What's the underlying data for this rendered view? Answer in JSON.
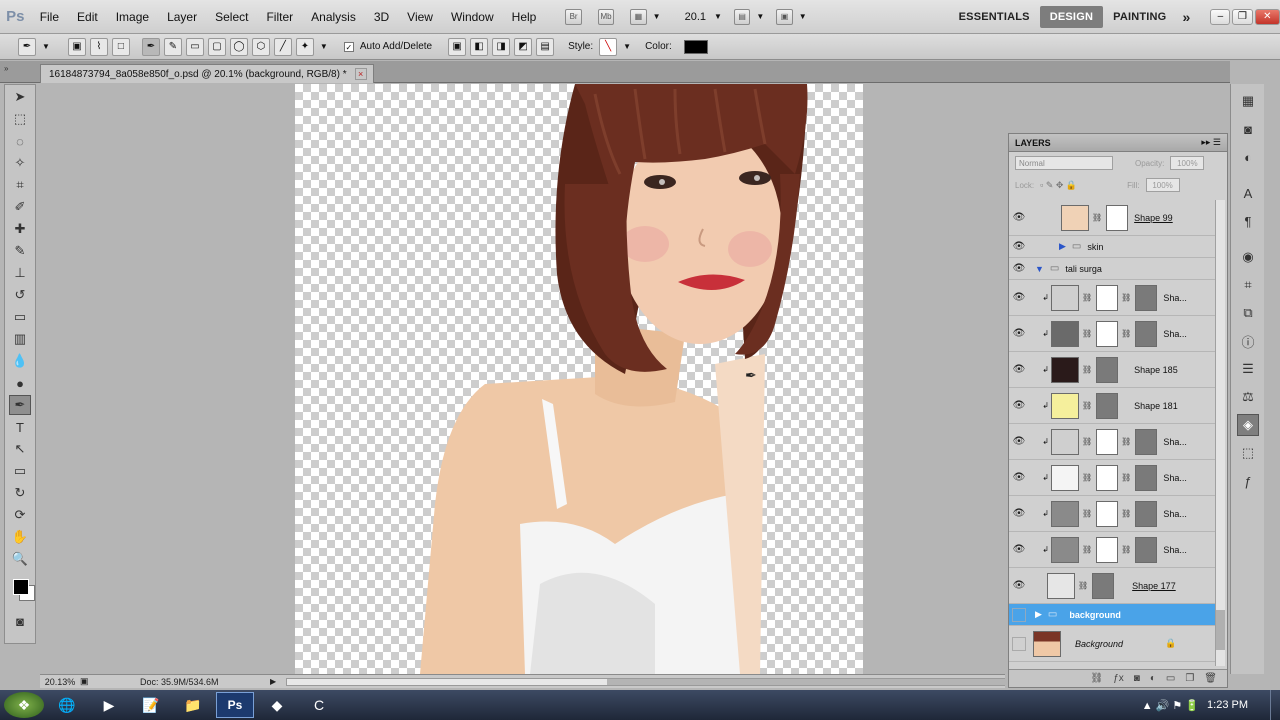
{
  "app": {
    "logo": "Ps"
  },
  "menu": [
    "File",
    "Edit",
    "Image",
    "Layer",
    "Select",
    "Filter",
    "Analysis",
    "3D",
    "View",
    "Window",
    "Help"
  ],
  "appbar": {
    "br": "Br",
    "mb": "Mb",
    "zoom": "20.1"
  },
  "workspaces": [
    "ESSENTIALS",
    "DESIGN",
    "PAINTING"
  ],
  "workspace_more": "»",
  "options": {
    "auto_add_delete": "Auto Add/Delete",
    "style_label": "Style:",
    "color_label": "Color:",
    "color_value": "#000000"
  },
  "document": {
    "tab_title": "16184873794_8a058e850f_o.psd @ 20.1% (background, RGB/8) *",
    "close": "×"
  },
  "status": {
    "zoom": "20.13%",
    "doc": "Doc: 35.9M/534.6M"
  },
  "layers_panel": {
    "title": "LAYERS",
    "blend_mode": "Normal",
    "opacity_label": "Opacity:",
    "opacity_value": "100%",
    "lock_label": "Lock:",
    "fill_label": "Fill:",
    "fill_value": "100%",
    "layers": [
      {
        "name": "Shape 99",
        "thumb": "#f0d2b6"
      },
      {
        "name": "skin",
        "group": true
      },
      {
        "name": "tali surga",
        "group": true,
        "expanded": true
      },
      {
        "name": "Sha...",
        "thumb": "#cfcfcf"
      },
      {
        "name": "Sha...",
        "thumb": "#6a6a6a"
      },
      {
        "name": "Shape 185",
        "thumb": "#2a1a1a"
      },
      {
        "name": "Shape 181",
        "thumb": "#f5ef9c"
      },
      {
        "name": "Sha...",
        "thumb": "#cfcfcf"
      },
      {
        "name": "Sha...",
        "thumb": "#f4f4f4"
      },
      {
        "name": "Sha...",
        "thumb": "#8a8a8a"
      },
      {
        "name": "Sha...",
        "thumb": "#8a8a8a"
      },
      {
        "name": "Shape 177",
        "thumb": "#e6e6e6"
      },
      {
        "name": "background",
        "group": true,
        "selected": true
      },
      {
        "name": "Background",
        "locked": true
      }
    ]
  },
  "taskbar": {
    "time": "1:23 PM"
  },
  "colors": {
    "accent": "#3c8fd8",
    "hair": "#6b2e20",
    "skin": "#efc9a8",
    "lips": "#c8303a"
  }
}
